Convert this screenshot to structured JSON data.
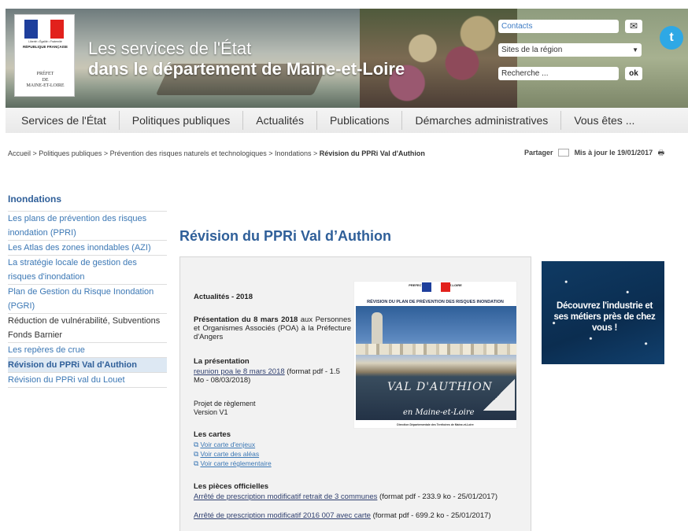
{
  "header": {
    "republic_motto": "Liberté • Égalité • Fraternité",
    "republic_name": "RÉPUBLIQUE FRANÇAISE",
    "prefet_lines": [
      "PRÉFET",
      "DE",
      "MAINE-ET-LOIRE"
    ],
    "title_line1": "Les services de l'État",
    "title_line2": "dans le département de Maine-et-Loire",
    "contacts_label": "Contacts",
    "sites_select_value": "Sites de la région",
    "search_placeholder": "Recherche ...",
    "search_button": "ok",
    "flag_colors": [
      "#1e3f9c",
      "#ffffff",
      "#e2211c"
    ]
  },
  "nav": {
    "items": [
      "Services de l'État",
      "Politiques publiques",
      "Actualités",
      "Publications",
      "Démarches administratives",
      "Vous êtes ..."
    ]
  },
  "breadcrumb": {
    "trail": "Accueil > Politiques publiques > Prévention des risques naturels et technologiques > Inondations > ",
    "current": "Révision du PPRi Val d'Authion"
  },
  "share": {
    "label": "Partager",
    "updated": "Mis à jour le 19/01/2017"
  },
  "sidebar": {
    "title": "Inondations",
    "items": [
      {
        "label": "Les plans de prévention des risques inondation (PPRI)"
      },
      {
        "label": "Les Atlas des zones inondables (AZI)"
      },
      {
        "label": "La stratégie locale de gestion des risques d'inondation"
      },
      {
        "label": "Plan de Gestion du Risque Inondation (PGRI)"
      },
      {
        "label": "Réduction de vulnérabilité, Subventions Fonds Barnier"
      },
      {
        "label": "Les repères de crue"
      },
      {
        "label": "Révision du PPRi Val d'Authion"
      },
      {
        "label": "Révision du PPRi val du Louet"
      }
    ]
  },
  "main": {
    "title": "Révision du PPRi Val d’Authion",
    "news_heading": "Actualités - 2018",
    "presentation_title": "Présentation du 8 mars 2018",
    "presentation_text": " aux Personnes et Organismes Associés (POA) à la Préfecture d'Angers",
    "la_presentation_heading": "La présentation",
    "presentation_link": "reunion poa le 8 mars 2018",
    "presentation_link_meta": " (format pdf - 1.5 Mo - 08/03/2018)",
    "projet_line1": "Projet de règlement",
    "projet_line2": "Version V1",
    "cartes_heading": "Les cartes",
    "cartes_links": [
      "Voir carte d'enjeux",
      "Voir carte des aléas",
      "Voir carte réglementaire"
    ],
    "pieces_heading": "Les pièces officielles",
    "piece1_link": "Arrêté de prescription modificatif retrait de 3 communes",
    "piece1_meta": " (format pdf - 233.9 ko - 25/01/2017)",
    "piece2_link": "Arrêté de prescription modificatif 2016 007 avec carte",
    "piece2_meta": " (format pdf - 699.2 ko - 25/01/2017)"
  },
  "poster": {
    "top": "PREFECTURE DE                    MAINE-ET-LOIRE",
    "title": "RÉVISION DU PLAN DE PRÉVENTION DES RISQUES INONDATION",
    "name": "VAL D'AUTHION",
    "subtitle": "en Maine-et-Loire",
    "footer": "Direction Départementale des Territoires de Maine-et-Loire"
  },
  "ad": {
    "text": "Découvrez l'industrie et ses métiers près de chez vous !"
  }
}
